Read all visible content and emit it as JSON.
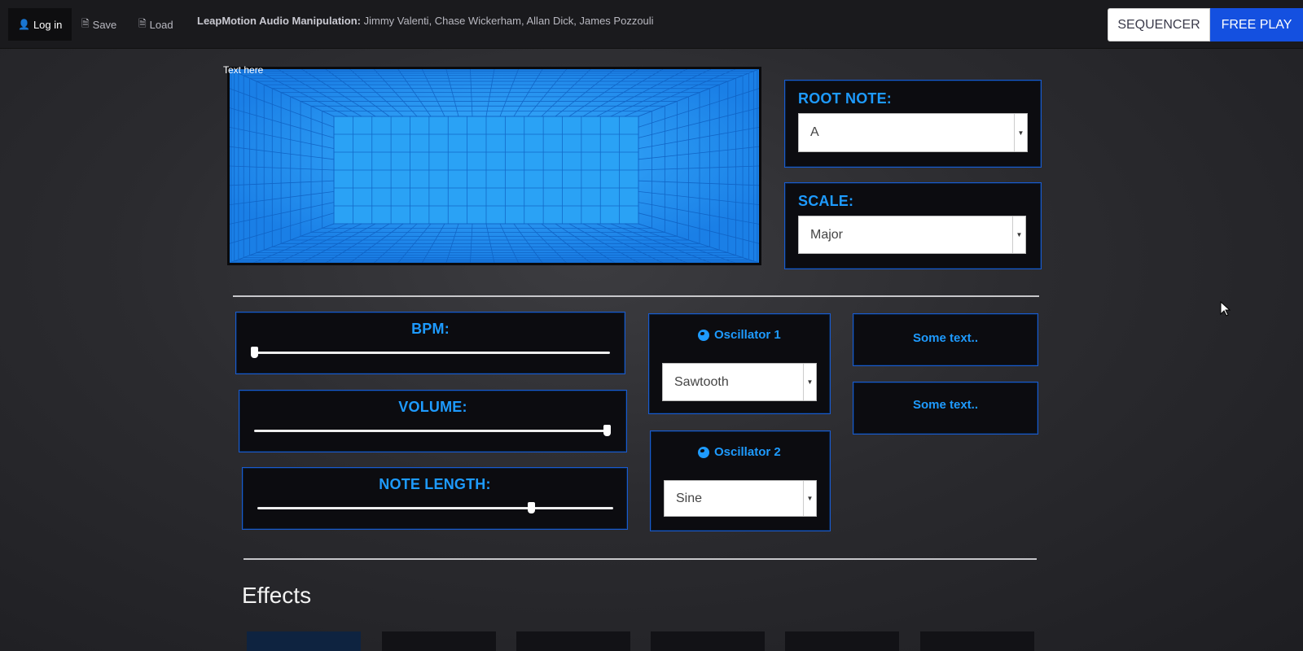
{
  "navbar": {
    "login_label": "Log in",
    "save_label": "Save",
    "load_label": "Load",
    "title_bold": "LeapMotion Audio Manipulation:",
    "title_authors": "Jimmy Valenti, Chase Wickerham, Allan Dick, James Pozzouli",
    "sequencer_label": "SEQUENCER",
    "freeplay_label": "FREE PLAY"
  },
  "visualizer": {
    "label": "Text here"
  },
  "root_note": {
    "heading": "ROOT NOTE:",
    "value": "A"
  },
  "scale": {
    "heading": "SCALE:",
    "value": "Major"
  },
  "bpm": {
    "heading": "BPM:",
    "level": 0.0
  },
  "volume": {
    "heading": "VOLUME:",
    "level": 0.99
  },
  "note_length": {
    "heading": "NOTE LENGTH:",
    "level": 0.77
  },
  "oscillator1": {
    "heading": "Oscillator 1",
    "value": "Sawtooth"
  },
  "oscillator2": {
    "heading": "Oscillator 2",
    "value": "Sine"
  },
  "text_panels": {
    "first": "Some text..",
    "second": "Some text.."
  },
  "effects": {
    "heading": "Effects"
  },
  "colors": {
    "accent": "#1e9bff",
    "panel_border": "#1a5bd0",
    "visualizer": "#1e8cf0",
    "freeplay_button": "#1450e0"
  }
}
